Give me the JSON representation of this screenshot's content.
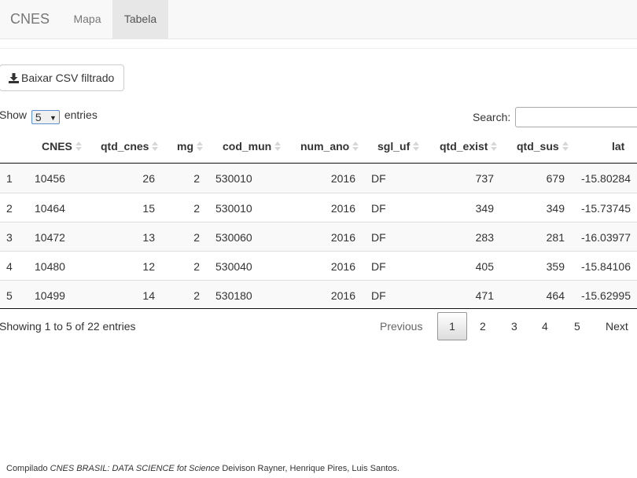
{
  "navbar": {
    "brand": "CNES",
    "tabs": [
      {
        "label": "Mapa",
        "active": false
      },
      {
        "label": "Tabela",
        "active": true
      }
    ]
  },
  "download_button": {
    "label": "Baixar CSV filtrado",
    "icon": "download-icon"
  },
  "length_menu": {
    "prefix": "Show",
    "selected": "5",
    "suffix": "entries"
  },
  "search": {
    "label": "Search:",
    "value": ""
  },
  "table": {
    "columns": [
      "",
      "CNES",
      "qtd_cnes",
      "mg",
      "cod_mun",
      "num_ano",
      "sgl_uf",
      "qtd_exist",
      "qtd_sus",
      "lat"
    ],
    "rows": [
      [
        "1",
        "10456",
        "26",
        "2",
        "530010",
        "2016",
        "DF",
        "737",
        "679",
        "-15.80284"
      ],
      [
        "2",
        "10464",
        "15",
        "2",
        "530010",
        "2016",
        "DF",
        "349",
        "349",
        "-15.73745"
      ],
      [
        "3",
        "10472",
        "13",
        "2",
        "530060",
        "2016",
        "DF",
        "283",
        "281",
        "-16.03977"
      ],
      [
        "4",
        "10480",
        "12",
        "2",
        "530040",
        "2016",
        "DF",
        "405",
        "359",
        "-15.84106"
      ],
      [
        "5",
        "10499",
        "14",
        "2",
        "530180",
        "2016",
        "DF",
        "471",
        "464",
        "-15.62995"
      ]
    ]
  },
  "info": "Showing 1 to 5 of 22 entries",
  "pagination": {
    "previous": "Previous",
    "pages": [
      "1",
      "2",
      "3",
      "4",
      "5"
    ],
    "current": "1",
    "next": "Next"
  },
  "footer": {
    "prefix": "Compilado",
    "title": "CNES BRASIL: DATA SCIENCE fot Science",
    "authors": "Deivison Rayner, Henrique Pires, Luis Santos."
  }
}
